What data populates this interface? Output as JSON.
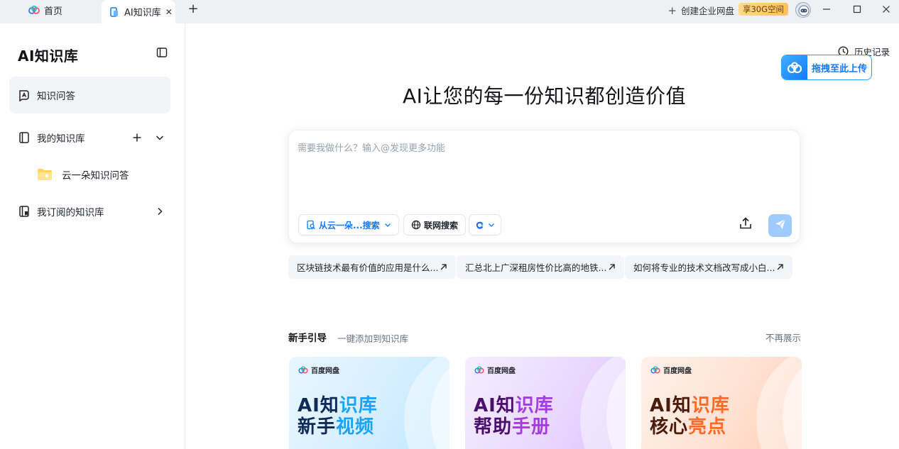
{
  "tabs": {
    "home_label": "首页",
    "active_label": "AI知识库",
    "close_glyph": "✕",
    "add_glyph": "+"
  },
  "titlebar": {
    "create_enterprise": "创建企业网盘",
    "promo_badge": "享30G空间"
  },
  "sidebar": {
    "title": "AI知识库",
    "items": [
      {
        "label": "知识问答"
      },
      {
        "label": "我的知识库"
      },
      {
        "label": "云一朵知识问答"
      },
      {
        "label": "我订阅的知识库"
      }
    ]
  },
  "main": {
    "history_label": "历史记录",
    "upload_drop_label": "拖拽至此上传",
    "hero_title": "AI让您的每一份知识都创造价值",
    "input_placeholder": "需要我做什么？输入@发现更多功能",
    "scope_chip": "从云一朵...搜索",
    "web_search_chip": "联网搜索",
    "suggestions": [
      {
        "text": "区块链技术最有价值的应用是什么..."
      },
      {
        "text": "汇总北上广深租房性价比高的地铁..."
      },
      {
        "text": "如何将专业的技术文档改写成小白..."
      }
    ],
    "guide": {
      "title": "新手引导",
      "subtitle": "一键添加到知识库",
      "dismiss": "不再展示",
      "cards": [
        {
          "brand": "百度网盘",
          "line1_a": "AI知",
          "line1_b": "识库",
          "line2_a": "新手",
          "line2_b": "视频"
        },
        {
          "brand": "百度网盘",
          "line1_a": "AI知",
          "line1_b": "识库",
          "line2_a": "帮助",
          "line2_b": "手册"
        },
        {
          "brand": "百度网盘",
          "line1_a": "AI知",
          "line1_b": "识库",
          "line2_a": "核心",
          "line2_b": "亮点"
        }
      ]
    }
  },
  "colors": {
    "accent": "#1677ff",
    "send_disabled": "#9fcbff",
    "tabbar_bg": "#eef0f4",
    "active_nav_bg": "#f2f4f7"
  },
  "icons": {
    "home_tab": "baidu-cloud-icon",
    "kb_tab": "knowledge-base-icon",
    "create": "plus-icon",
    "avatar": "astronaut-avatar-icon",
    "history": "clock-icon",
    "upload": "upload-icon",
    "send": "paper-plane-icon",
    "web": "globe-icon"
  }
}
